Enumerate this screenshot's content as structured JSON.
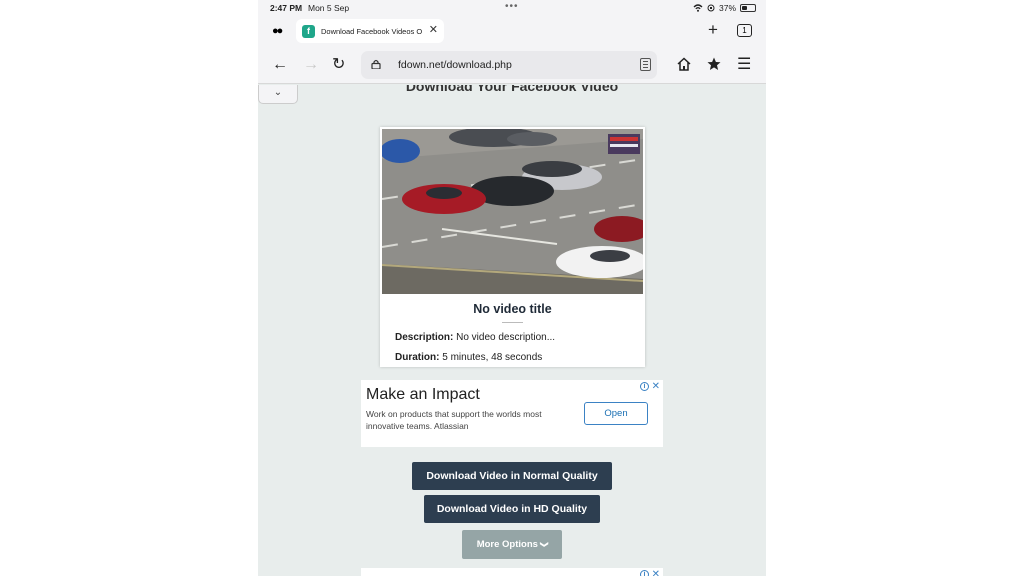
{
  "status_bar": {
    "time": "2:47 PM",
    "date": "Mon 5 Sep",
    "battery": "37%",
    "battery_level": 0.37
  },
  "tab_bar": {
    "tab_title": "Download Facebook Videos O",
    "favicon_letter": "f",
    "tab_count": "1"
  },
  "toolbar": {
    "url": "fdown.net/download.php"
  },
  "page": {
    "heading": "Download Your Facebook Video",
    "video": {
      "title": "No video title",
      "description_label": "Description:",
      "description": "No video description...",
      "duration_label": "Duration:",
      "duration": "5 minutes, 48 seconds"
    },
    "ad": {
      "title": "Make an Impact",
      "body": "Work on products that support the worlds most innovative teams. Atlassian",
      "button": "Open"
    },
    "buttons": {
      "normal": "Download Video in Normal Quality",
      "hd": "Download Video in HD Quality",
      "more": "More Options"
    }
  },
  "colors": {
    "page_bg": "#e8edec",
    "primary_button": "#2d3e50",
    "secondary_button": "#95a5a6",
    "favicon": "#1fa68a",
    "ad_accent": "#3b82c4"
  }
}
